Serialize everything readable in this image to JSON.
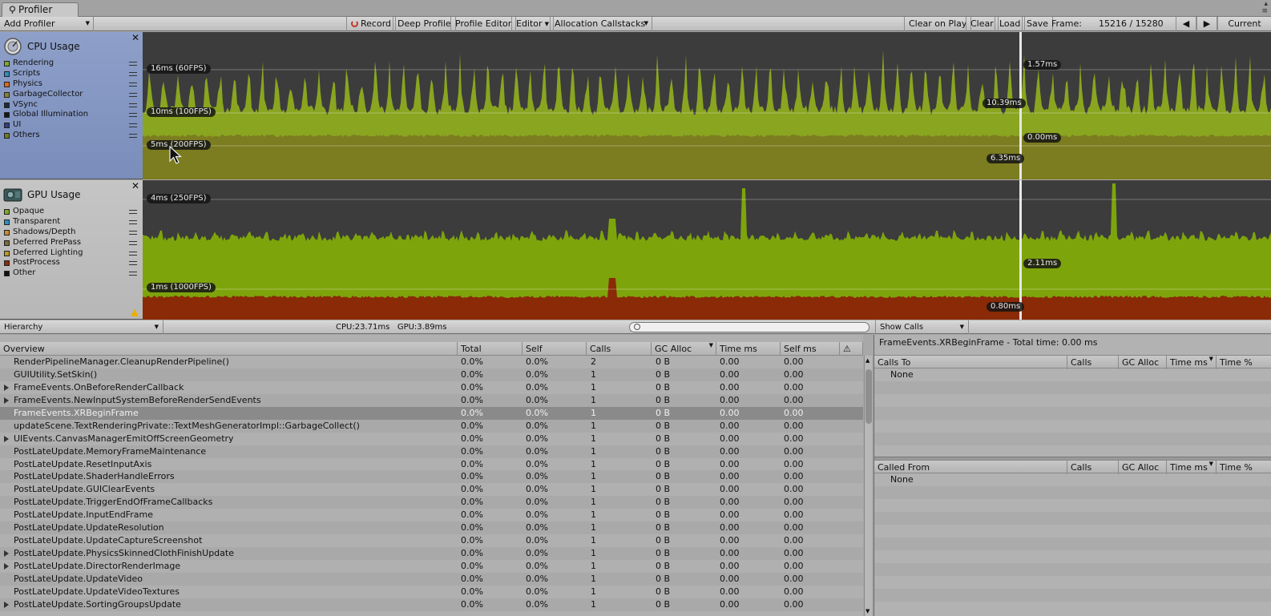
{
  "window": {
    "tab_title": "Profiler",
    "win_buttons": "▴\n≡"
  },
  "toolbar": {
    "add_profiler": "Add Profiler",
    "record": "Record",
    "deep_profile": "Deep Profile",
    "profile_editor": "Profile Editor",
    "editor": "Editor",
    "allocation_callstacks": "Allocation Callstacks",
    "clear_on_play": "Clear on Play",
    "clear": "Clear",
    "load": "Load",
    "save": "Save",
    "frame_label": "Frame:",
    "frame_value": "15216 / 15280",
    "current": "Current"
  },
  "cpu": {
    "title": "CPU Usage",
    "legend": [
      {
        "label": "Rendering",
        "color": "#7fa82a"
      },
      {
        "label": "Scripts",
        "color": "#2f8fbf"
      },
      {
        "label": "Physics",
        "color": "#d96a1e"
      },
      {
        "label": "GarbageCollector",
        "color": "#86803a"
      },
      {
        "label": "VSync",
        "color": "#1c2a3c"
      },
      {
        "label": "Global Illumination",
        "color": "#101820"
      },
      {
        "label": "UI",
        "color": "#2f3f7f"
      },
      {
        "label": "Others",
        "color": "#6f7a2a"
      }
    ],
    "labels": {
      "line16": "16ms (60FPS)",
      "line10": "10ms (100FPS)",
      "line5": "5ms (200FPS)",
      "val_top": "1.57ms",
      "val_scripts": "10.39ms",
      "val_zero": "0.00ms",
      "val_other": "6.35ms"
    }
  },
  "gpu": {
    "title": "GPU Usage",
    "legend": [
      {
        "label": "Opaque",
        "color": "#7fa82a"
      },
      {
        "label": "Transparent",
        "color": "#2f8fbf"
      },
      {
        "label": "Shadows/Depth",
        "color": "#c88a30"
      },
      {
        "label": "Deferred PrePass",
        "color": "#7a6a3a"
      },
      {
        "label": "Deferred Lighting",
        "color": "#b89a2a"
      },
      {
        "label": "PostProcess",
        "color": "#8b2a0f"
      },
      {
        "label": "Other",
        "color": "#111111"
      }
    ],
    "labels": {
      "line4": "4ms (250FPS)",
      "line1": "1ms (1000FPS)",
      "val_opaque": "2.11ms",
      "val_post": "0.80ms"
    }
  },
  "hierarchy_bar": {
    "view": "Hierarchy",
    "cpu_stat": "CPU:23.71ms",
    "gpu_stat": "GPU:3.89ms",
    "search_placeholder": "",
    "show_calls": "Show Calls"
  },
  "table": {
    "columns": [
      "Overview",
      "Total",
      "Self",
      "Calls",
      "GC Alloc",
      "Time ms",
      "Self ms",
      "⚠"
    ],
    "rows": [
      {
        "name": "RenderPipelineManager.CleanupRenderPipeline()",
        "expand": false,
        "total": "0.0%",
        "self": "0.0%",
        "calls": "2",
        "gc": "0 B",
        "time": "0.00",
        "selfms": "0.00"
      },
      {
        "name": "GUIUtility.SetSkin()",
        "expand": false,
        "total": "0.0%",
        "self": "0.0%",
        "calls": "1",
        "gc": "0 B",
        "time": "0.00",
        "selfms": "0.00"
      },
      {
        "name": "FrameEvents.OnBeforeRenderCallback",
        "expand": true,
        "total": "0.0%",
        "self": "0.0%",
        "calls": "1",
        "gc": "0 B",
        "time": "0.00",
        "selfms": "0.00"
      },
      {
        "name": "FrameEvents.NewInputSystemBeforeRenderSendEvents",
        "expand": true,
        "total": "0.0%",
        "self": "0.0%",
        "calls": "1",
        "gc": "0 B",
        "time": "0.00",
        "selfms": "0.00"
      },
      {
        "name": "FrameEvents.XRBeginFrame",
        "expand": false,
        "total": "0.0%",
        "self": "0.0%",
        "calls": "1",
        "gc": "0 B",
        "time": "0.00",
        "selfms": "0.00"
      },
      {
        "name": "updateScene.TextRenderingPrivate::TextMeshGeneratorImpl::GarbageCollect()",
        "expand": false,
        "total": "0.0%",
        "self": "0.0%",
        "calls": "1",
        "gc": "0 B",
        "time": "0.00",
        "selfms": "0.00"
      },
      {
        "name": "UIEvents.CanvasManagerEmitOffScreenGeometry",
        "expand": true,
        "total": "0.0%",
        "self": "0.0%",
        "calls": "1",
        "gc": "0 B",
        "time": "0.00",
        "selfms": "0.00"
      },
      {
        "name": "PostLateUpdate.MemoryFrameMaintenance",
        "expand": false,
        "total": "0.0%",
        "self": "0.0%",
        "calls": "1",
        "gc": "0 B",
        "time": "0.00",
        "selfms": "0.00"
      },
      {
        "name": "PostLateUpdate.ResetInputAxis",
        "expand": false,
        "total": "0.0%",
        "self": "0.0%",
        "calls": "1",
        "gc": "0 B",
        "time": "0.00",
        "selfms": "0.00"
      },
      {
        "name": "PostLateUpdate.ShaderHandleErrors",
        "expand": false,
        "total": "0.0%",
        "self": "0.0%",
        "calls": "1",
        "gc": "0 B",
        "time": "0.00",
        "selfms": "0.00"
      },
      {
        "name": "PostLateUpdate.GUIClearEvents",
        "expand": false,
        "total": "0.0%",
        "self": "0.0%",
        "calls": "1",
        "gc": "0 B",
        "time": "0.00",
        "selfms": "0.00"
      },
      {
        "name": "PostLateUpdate.TriggerEndOfFrameCallbacks",
        "expand": false,
        "total": "0.0%",
        "self": "0.0%",
        "calls": "1",
        "gc": "0 B",
        "time": "0.00",
        "selfms": "0.00"
      },
      {
        "name": "PostLateUpdate.InputEndFrame",
        "expand": false,
        "total": "0.0%",
        "self": "0.0%",
        "calls": "1",
        "gc": "0 B",
        "time": "0.00",
        "selfms": "0.00"
      },
      {
        "name": "PostLateUpdate.UpdateResolution",
        "expand": false,
        "total": "0.0%",
        "self": "0.0%",
        "calls": "1",
        "gc": "0 B",
        "time": "0.00",
        "selfms": "0.00"
      },
      {
        "name": "PostLateUpdate.UpdateCaptureScreenshot",
        "expand": false,
        "total": "0.0%",
        "self": "0.0%",
        "calls": "1",
        "gc": "0 B",
        "time": "0.00",
        "selfms": "0.00"
      },
      {
        "name": "PostLateUpdate.PhysicsSkinnedClothFinishUpdate",
        "expand": true,
        "total": "0.0%",
        "self": "0.0%",
        "calls": "1",
        "gc": "0 B",
        "time": "0.00",
        "selfms": "0.00"
      },
      {
        "name": "PostLateUpdate.DirectorRenderImage",
        "expand": true,
        "total": "0.0%",
        "self": "0.0%",
        "calls": "1",
        "gc": "0 B",
        "time": "0.00",
        "selfms": "0.00"
      },
      {
        "name": "PostLateUpdate.UpdateVideo",
        "expand": false,
        "total": "0.0%",
        "self": "0.0%",
        "calls": "1",
        "gc": "0 B",
        "time": "0.00",
        "selfms": "0.00"
      },
      {
        "name": "PostLateUpdate.UpdateVideoTextures",
        "expand": false,
        "total": "0.0%",
        "self": "0.0%",
        "calls": "1",
        "gc": "0 B",
        "time": "0.00",
        "selfms": "0.00"
      },
      {
        "name": "PostLateUpdate.SortingGroupsUpdate",
        "expand": true,
        "total": "0.0%",
        "self": "0.0%",
        "calls": "1",
        "gc": "0 B",
        "time": "0.00",
        "selfms": "0.00"
      }
    ],
    "selected_index": 4
  },
  "details": {
    "title": "FrameEvents.XRBeginFrame - Total time: 0.00 ms",
    "calls_to": {
      "columns": [
        "Calls To",
        "Calls",
        "GC Alloc",
        "Time ms",
        "Time %"
      ],
      "rows": [
        "None"
      ]
    },
    "called_from": {
      "columns": [
        "Called From",
        "Calls",
        "GC Alloc",
        "Time ms",
        "Time %"
      ],
      "rows": [
        "None"
      ]
    }
  }
}
